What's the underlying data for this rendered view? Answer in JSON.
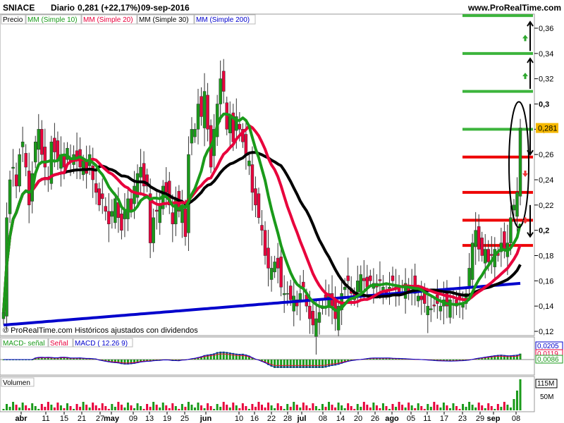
{
  "header": {
    "symbol": "SNIACE",
    "period": "Diario",
    "quote": "0,281 (+22,17%)",
    "date": "09-sep-2016",
    "site": "www.ProRealTime.com"
  },
  "legend": [
    {
      "label": "Precio",
      "color": "#000000"
    },
    {
      "label": "MM (Simple 10)",
      "color": "#1a9a1a"
    },
    {
      "label": "MM (Simple 20)",
      "color": "#e8003c"
    },
    {
      "label": "MM (Simple 30)",
      "color": "#000000"
    },
    {
      "label": "MM (Simple 200)",
      "color": "#0000cc"
    }
  ],
  "watermark": "© ProRealTime.com  Históricos ajustados con dividendos",
  "macd": {
    "legend": [
      {
        "label": "MACD-  señal",
        "color": "#1a9a1a"
      },
      {
        "label": "Señal",
        "color": "#e8003c"
      },
      {
        "label": "MACD ( 12.26 9)",
        "color": "#0000cc"
      }
    ],
    "labels": [
      "0,0205",
      "0,0119",
      "0,0086"
    ]
  },
  "volume": {
    "title": "Volumen",
    "labels": [
      "115M",
      "50M"
    ]
  },
  "colors": {
    "up": "#1a9a1a",
    "down": "#e8003c",
    "ma10": "#1a9a1a",
    "ma20": "#e8003c",
    "ma30": "#000000",
    "ma200": "#0000cc",
    "green_level": "#3cb43c",
    "red_level": "#ee0000",
    "last_price_bg": "#f5b800"
  },
  "chart_data": {
    "type": "candlestick",
    "title": "SNIACE Diario",
    "y_axis": {
      "ticks": [
        "0,36",
        "0,34",
        "0,32",
        "0,3",
        "0,28",
        "0,26",
        "0,24",
        "0,22",
        "0,2",
        "0,18",
        "0,16",
        "0,14",
        "0,12"
      ],
      "range": [
        0.12,
        0.37
      ]
    },
    "x_axis": {
      "ticks": [
        "abr",
        "11",
        "15",
        "21",
        "27",
        "may",
        "09",
        "13",
        "19",
        "25",
        "jun",
        "10",
        "16",
        "22",
        "28",
        "jul",
        "08",
        "14",
        "20",
        "26",
        "ago",
        "05",
        "11",
        "17",
        "23",
        "29",
        "sep",
        "08"
      ]
    },
    "last_price": "0,281",
    "horizontal_levels": {
      "green": [
        0.37,
        0.34,
        0.31,
        0.28
      ],
      "red": [
        0.258,
        0.23,
        0.208,
        0.188
      ]
    },
    "close": [
      0.135,
      0.21,
      0.24,
      0.25,
      0.235,
      0.26,
      0.27,
      0.25,
      0.22,
      0.245,
      0.27,
      0.28,
      0.26,
      0.25,
      0.24,
      0.27,
      0.262,
      0.255,
      0.26,
      0.25,
      0.265,
      0.255,
      0.26,
      0.255,
      0.25,
      0.255,
      0.245,
      0.26,
      0.24,
      0.23,
      0.22,
      0.225,
      0.215,
      0.205,
      0.215,
      0.225,
      0.21,
      0.2,
      0.215,
      0.225,
      0.215,
      0.235,
      0.245,
      0.25,
      0.235,
      0.235,
      0.19,
      0.21,
      0.215,
      0.22,
      0.235,
      0.23,
      0.22,
      0.205,
      0.225,
      0.215,
      0.22,
      0.195,
      0.26,
      0.28,
      0.28,
      0.3,
      0.29,
      0.31,
      0.28,
      0.25,
      0.28,
      0.3,
      0.32,
      0.31,
      0.28,
      0.29,
      0.27,
      0.29,
      0.28,
      0.27,
      0.26,
      0.255,
      0.23,
      0.22,
      0.21,
      0.2,
      0.18,
      0.17,
      0.17,
      0.175,
      0.17,
      0.155,
      0.15,
      0.15,
      0.145,
      0.148,
      0.14,
      0.15,
      0.155,
      0.14,
      0.13,
      0.125,
      0.13,
      0.135,
      0.14,
      0.145,
      0.15,
      0.14,
      0.13,
      0.14,
      0.15,
      0.155,
      0.16,
      0.15,
      0.145,
      0.16,
      0.165,
      0.16,
      0.155,
      0.16,
      0.158,
      0.155,
      0.16,
      0.155,
      0.15,
      0.155,
      0.16,
      0.155,
      0.15,
      0.155,
      0.158,
      0.152,
      0.155,
      0.15,
      0.148,
      0.145,
      0.142,
      0.14,
      0.138,
      0.14,
      0.142,
      0.14,
      0.145,
      0.14,
      0.145,
      0.142,
      0.14,
      0.145,
      0.142,
      0.15,
      0.17,
      0.19,
      0.2,
      0.185,
      0.18,
      0.185,
      0.175,
      0.18,
      0.185,
      0.18,
      0.19,
      0.185,
      0.19,
      0.21,
      0.22,
      0.23,
      0.281
    ],
    "volume_note": "daily traded volume; last bar ~115M"
  }
}
